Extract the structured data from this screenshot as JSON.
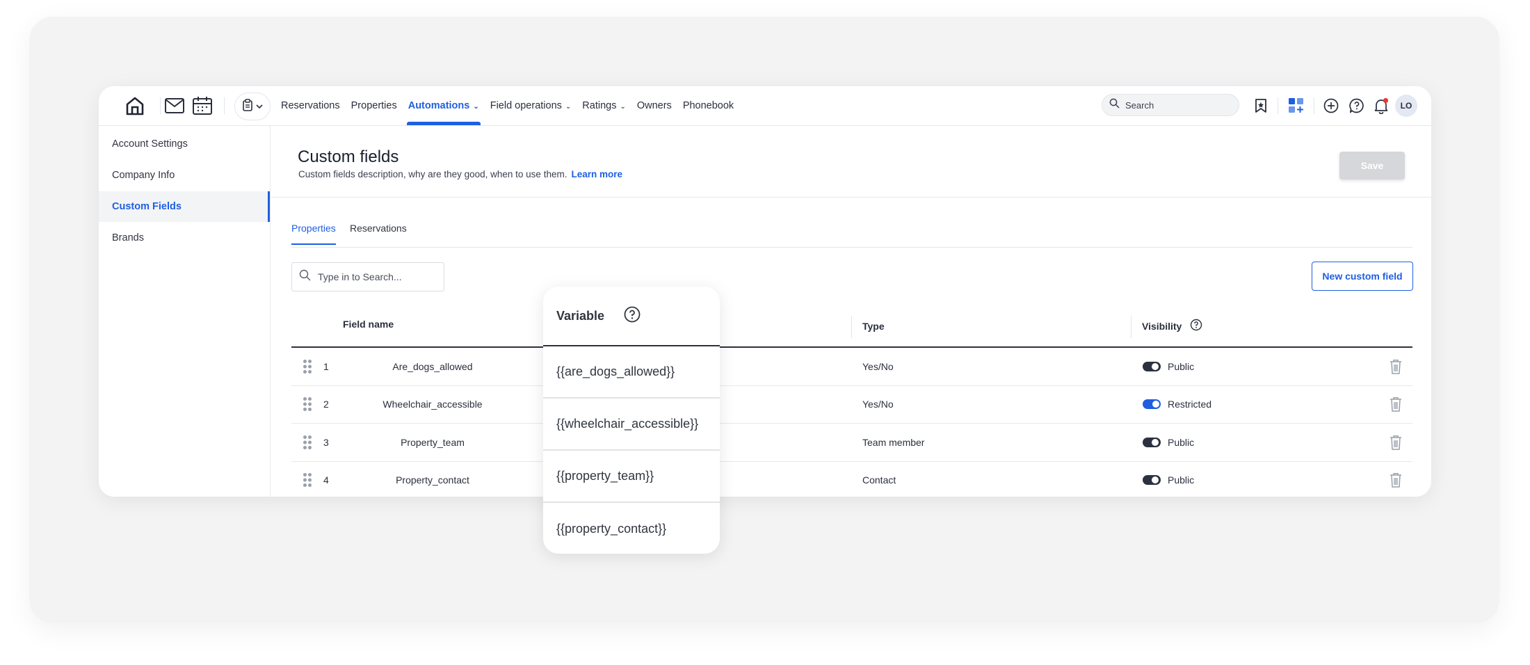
{
  "nav": {
    "items": [
      {
        "label": "Reservations",
        "active": false,
        "dropdown": false
      },
      {
        "label": "Properties",
        "active": false,
        "dropdown": false
      },
      {
        "label": "Automations",
        "active": true,
        "dropdown": true
      },
      {
        "label": "Field operations",
        "active": false,
        "dropdown": true
      },
      {
        "label": "Ratings",
        "active": false,
        "dropdown": true
      },
      {
        "label": "Owners",
        "active": false,
        "dropdown": false
      },
      {
        "label": "Phonebook",
        "active": false,
        "dropdown": false
      }
    ],
    "search_placeholder": "Search",
    "avatar_initials": "LO"
  },
  "sidebar": {
    "items": [
      {
        "label": "Account Settings"
      },
      {
        "label": "Company Info"
      },
      {
        "label": "Custom Fields"
      },
      {
        "label": "Brands"
      }
    ]
  },
  "main": {
    "title": "Custom fields",
    "description": "Custom fields description, why are they good, when to use them.",
    "learn_more": "Learn more",
    "save_label": "Save",
    "tabs": [
      {
        "label": "Properties"
      },
      {
        "label": "Reservations"
      }
    ],
    "search_placeholder": "Type in to Search...",
    "new_field_label": "New custom field"
  },
  "table": {
    "headers": {
      "field_name": "Field name",
      "type": "Type",
      "visibility": "Visibility"
    },
    "rows": [
      {
        "index": "1",
        "name": "Are_dogs_allowed",
        "type": "Yes/No",
        "visibility": "Public",
        "toggle_on": false
      },
      {
        "index": "2",
        "name": "Wheelchair_accessible",
        "type": "Yes/No",
        "visibility": "Restricted",
        "toggle_on": true
      },
      {
        "index": "3",
        "name": "Property_team",
        "type": "Team member",
        "visibility": "Public",
        "toggle_on": false
      },
      {
        "index": "4",
        "name": "Property_contact",
        "type": "Contact",
        "visibility": "Public",
        "toggle_on": false
      }
    ]
  },
  "variable_column": {
    "header": "Variable",
    "values": [
      "{{are_dogs_allowed}}",
      "{{wheelchair_accessible}}",
      "{{property_team}}",
      "{{property_contact}}"
    ]
  },
  "colors": {
    "accent": "#1f5fe0",
    "notification_dot": "#e53935",
    "text_dark": "#1f2433",
    "disabled_button": "#d6d7da"
  },
  "icons": [
    "home-icon",
    "mail-icon",
    "calendar-icon",
    "clipboard-icon",
    "search-icon",
    "bookmark-icon",
    "apps-add-icon",
    "plus-circle-icon",
    "help-chat-icon",
    "bell-icon",
    "drag-handle-icon",
    "trash-icon",
    "help-circle-icon"
  ]
}
